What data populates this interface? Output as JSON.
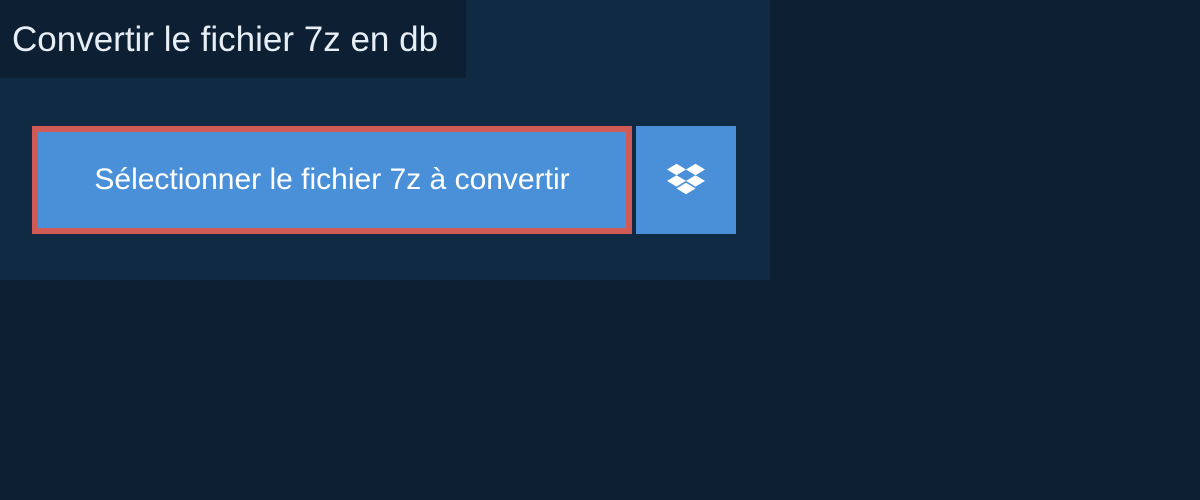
{
  "title": "Convertir le fichier 7z en db",
  "select_button_label": "Sélectionner le fichier 7z à convertir",
  "colors": {
    "background": "#0c1f33",
    "panel": "#102a43",
    "button": "#4a90d9",
    "border_highlight": "#d05a55",
    "text": "#e8eef5"
  }
}
